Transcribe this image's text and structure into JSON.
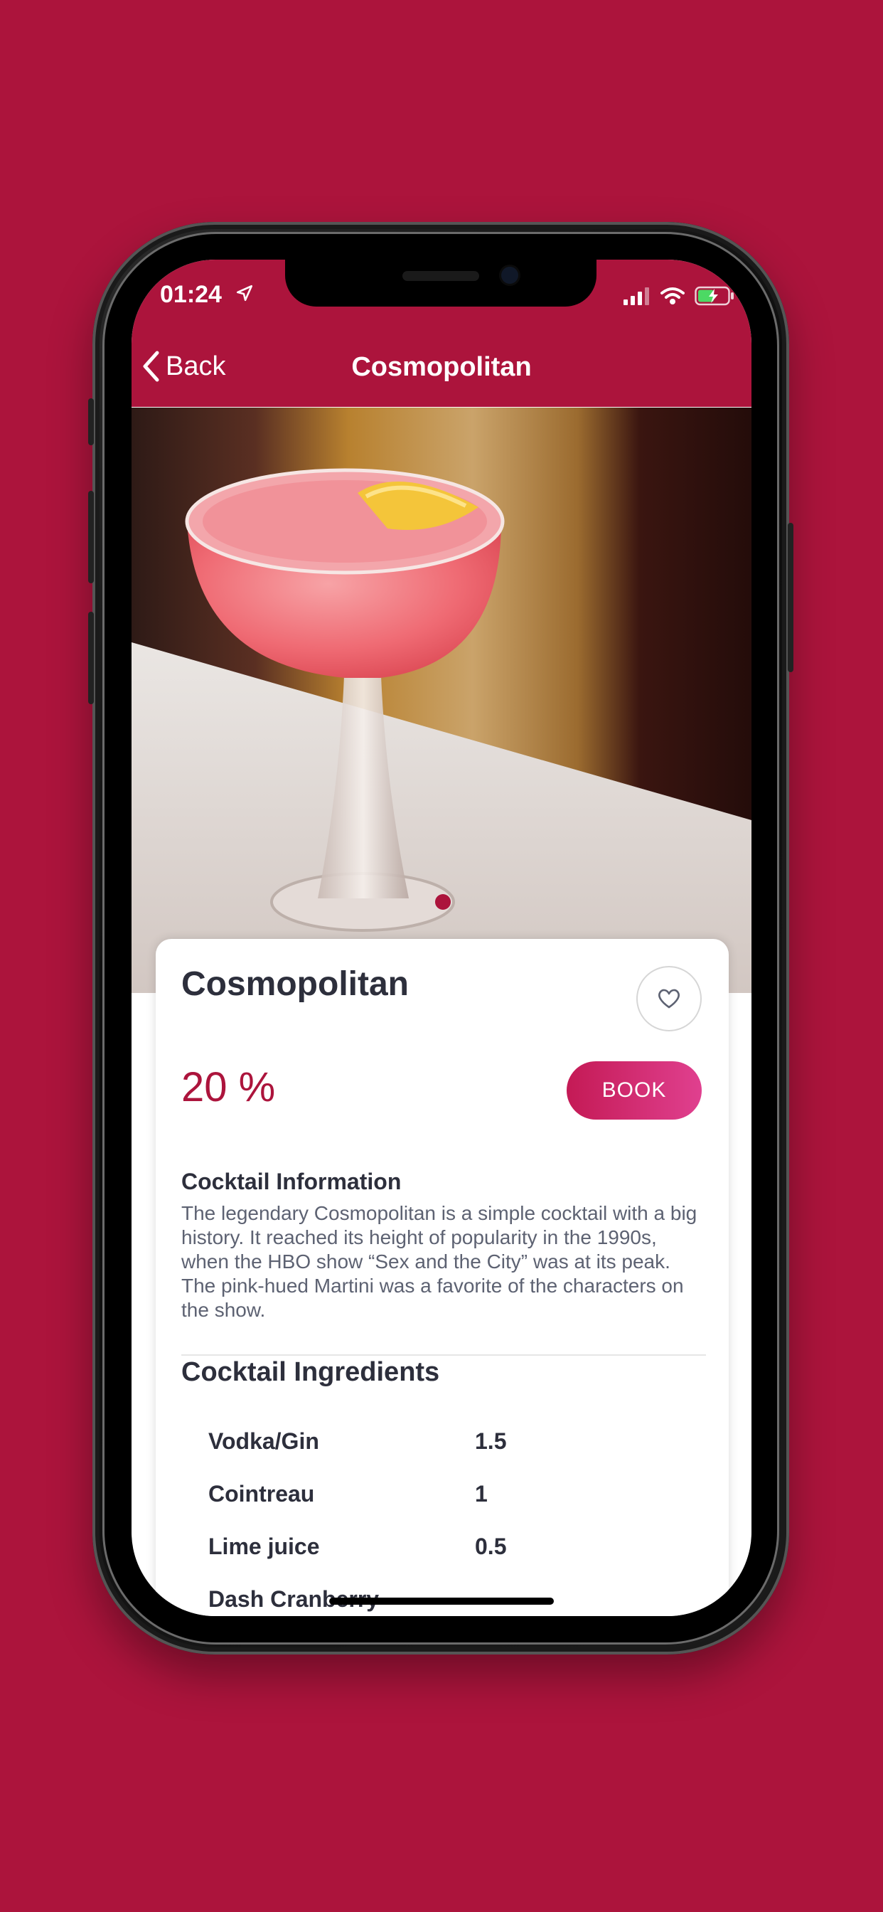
{
  "status_bar": {
    "time": "01:24"
  },
  "nav": {
    "back_label": "Back",
    "title": "Cosmopolitan"
  },
  "hero": {
    "active_slide_index": 0,
    "slide_count": 1
  },
  "product": {
    "name": "Cosmopolitan",
    "discount": "20 %",
    "book_label": "BOOK",
    "info_heading": "Cocktail Information",
    "info_text": "The legendary Cosmopolitan is a simple cocktail with a big history. It reached its height of popularity in the 1990s, when the HBO show “Sex and the City” was at its peak. The pink-hued Martini was a favorite of the characters on the show.",
    "ingredients_heading": "Cocktail Ingredients",
    "ingredients": [
      {
        "name": "Vodka/Gin",
        "amount": "1.5"
      },
      {
        "name": "Cointreau",
        "amount": "1"
      },
      {
        "name": "Lime juice",
        "amount": "0.5"
      },
      {
        "name": "Dash Cranberry",
        "amount": ""
      }
    ]
  },
  "colors": {
    "brand": "#ac143c",
    "button_gradient_start": "#c41a55",
    "button_gradient_end": "#e0408f",
    "text_dark": "#2d2f3c",
    "text_body": "#5d6272"
  },
  "icons": [
    "location-arrow-icon",
    "signal-icon",
    "wifi-icon",
    "battery-charging-icon",
    "chevron-left-icon",
    "heart-outline-icon"
  ]
}
